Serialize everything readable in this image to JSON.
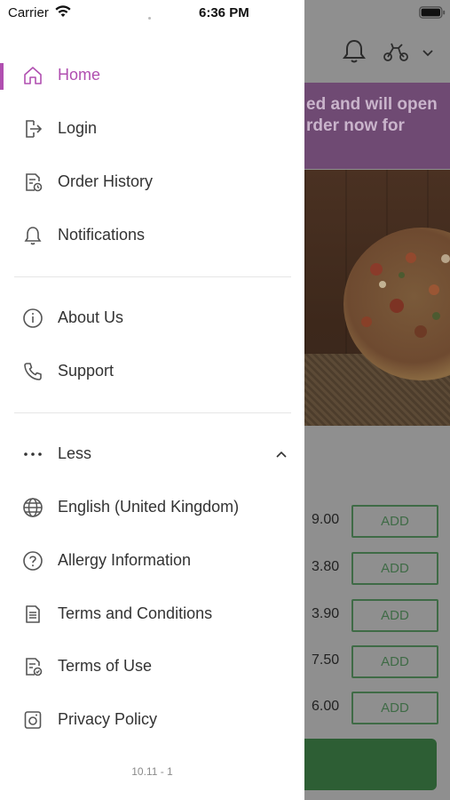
{
  "status_bar": {
    "carrier": "Carrier",
    "time": "6:36 PM"
  },
  "drawer": {
    "primary_items": [
      {
        "label": "Home",
        "icon": "home-icon",
        "active": true
      },
      {
        "label": "Login",
        "icon": "login-icon"
      },
      {
        "label": "Order History",
        "icon": "order-history-icon"
      },
      {
        "label": "Notifications",
        "icon": "bell-icon"
      }
    ],
    "secondary_items": [
      {
        "label": "About Us",
        "icon": "info-icon"
      },
      {
        "label": "Support",
        "icon": "phone-icon"
      }
    ],
    "more_toggle": {
      "label": "Less",
      "icon": "ellipsis-icon",
      "expanded": true
    },
    "extra_items": [
      {
        "label": "English (United Kingdom)",
        "icon": "globe-icon"
      },
      {
        "label": "Allergy Information",
        "icon": "question-icon"
      },
      {
        "label": "Terms and Conditions",
        "icon": "document-icon"
      },
      {
        "label": "Terms of Use",
        "icon": "document-check-icon"
      },
      {
        "label": "Privacy Policy",
        "icon": "privacy-icon"
      }
    ],
    "version": "10.11 - 1"
  },
  "background_app": {
    "banner_line1": "ed and will open",
    "banner_line2": "rder now for",
    "menu_rows": [
      {
        "price": "9.00",
        "add_label": "ADD"
      },
      {
        "price": "3.80",
        "add_label": "ADD"
      },
      {
        "price": "3.90",
        "add_label": "ADD"
      },
      {
        "price": "7.50",
        "add_label": "ADD"
      },
      {
        "price": "6.00",
        "add_label": "ADD"
      }
    ]
  },
  "colors": {
    "accent": "#b04fb0",
    "text": "#333333",
    "divider": "#e6e6e6",
    "add_button": "#3f6b46",
    "banner": "#6f4a73"
  }
}
